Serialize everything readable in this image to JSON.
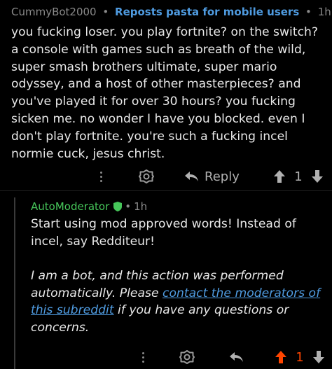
{
  "comment": {
    "author": "CummyBot2000",
    "separator": "•",
    "subreddit_note": "Reposts pasta for mobile users",
    "age": "1h",
    "body": "you fucking loser. you play fortnite? on the switch? a console with games such as breath of the wild, super smash brothers ultimate, super mario odyssey, and a host of other masterpieces? and you've played it for over 30 hours? you fucking sicken me. no wonder I have you blocked. even I don't play fortnite. you're such a fucking incel normie cuck, jesus christ.",
    "actions": {
      "more_icon": "vertical-dots-icon",
      "award_icon": "award-icon",
      "reply_icon": "reply-arrow-icon",
      "reply_label": "Reply",
      "upvote_icon": "upvote-icon",
      "score": "1",
      "downvote_icon": "downvote-icon"
    }
  },
  "reply": {
    "author": "AutoModerator",
    "mod_badge_icon": "shield-icon",
    "separator": "•",
    "age": "1h",
    "body": "Start using mod approved words! Instead of incel, say Redditeur!",
    "bot_text_before": "I am a bot, and this action was performed automatically. Please ",
    "bot_link": "contact the moderators of this subreddit",
    "bot_text_after": " if you have any questions or concerns.",
    "actions": {
      "more_icon": "vertical-dots-icon",
      "award_icon": "award-icon",
      "reply_icon": "reply-arrow-icon",
      "upvote_icon": "upvote-icon",
      "score": "1",
      "downvote_icon": "downvote-icon"
    }
  },
  "colors": {
    "background": "#000000",
    "subreddit_link": "#4f9be0",
    "automod_author": "#46c65a",
    "upvoted": "#ff4500",
    "muted": "#8a8a8a"
  }
}
